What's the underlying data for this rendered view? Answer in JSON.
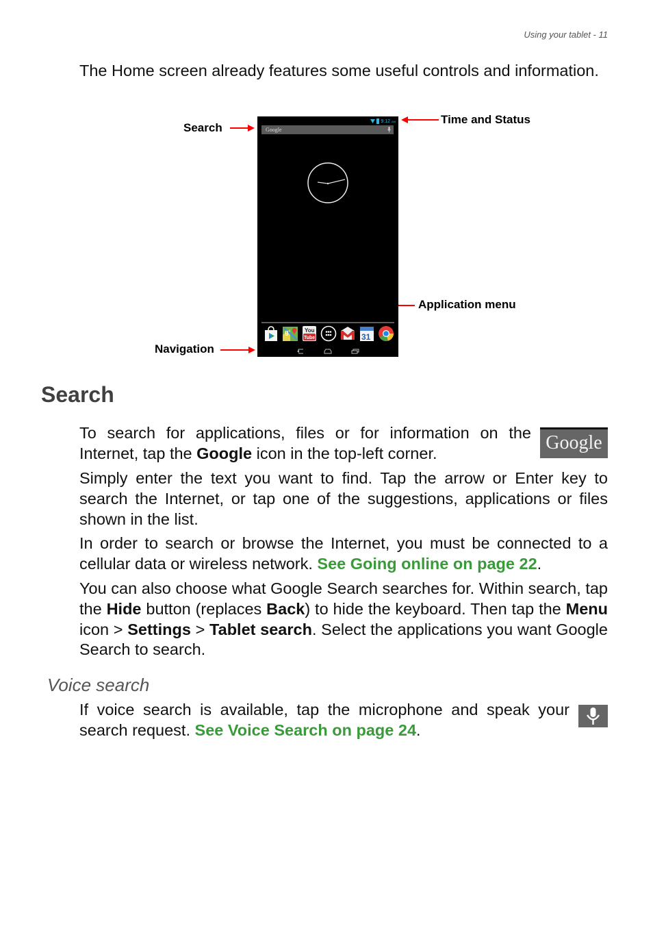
{
  "header": {
    "running_title": "Using your tablet - 11"
  },
  "intro": {
    "text": "The Home screen already features some useful controls and information."
  },
  "figure": {
    "labels": {
      "search": "Search",
      "time_status": "Time and Status",
      "app_menu": "Application menu",
      "navigation": "Navigation"
    },
    "arrow_color": "#ff0000",
    "screen": {
      "search_bar_text": "Google",
      "status_time": "9:12",
      "status_ampm": "AM",
      "dock_apps": [
        "play-store",
        "maps",
        "youtube",
        "app-launcher",
        "gmail",
        "calendar",
        "chrome"
      ],
      "calendar_day": "31",
      "youtube_top": "You",
      "youtube_bottom": "Tube",
      "nav_buttons": [
        "back",
        "home",
        "recent-apps"
      ]
    }
  },
  "search_section": {
    "heading": "Search",
    "p1": {
      "before": "To search for applications, files or for information on the Internet, tap the ",
      "bold": "Google",
      "after": "  icon in the top-left corner."
    },
    "google_icon_text": "Google",
    "p2": "Simply enter the text you want to find. Tap the arrow or Enter key to search the Internet, or tap one of the suggestions, applications or files shown in the list.",
    "p3": {
      "before": "In order to search or browse the Internet, you must be connected to a cellular data or wireless network. ",
      "link": "See Going online on page 22",
      "after": "."
    },
    "p4": {
      "t1": "You can also choose what Google Search searches for. Within search, tap the ",
      "b1": "Hide",
      "t2": " button (replaces ",
      "b2": "Back",
      "t3": ") to hide the keyboard. Then tap the ",
      "b3": "Menu",
      "t4": " icon > ",
      "b4": "Settings",
      "t5": " > ",
      "b5": "Tablet search",
      "t6": ". Select the applications you want Google Search to search."
    },
    "link_color": "#3a9a3a"
  },
  "voice_section": {
    "heading": "Voice search",
    "p1": {
      "before": "If voice search is available, tap the microphone and speak your search request. ",
      "link": "See Voice Search on page 24",
      "after": "."
    }
  }
}
